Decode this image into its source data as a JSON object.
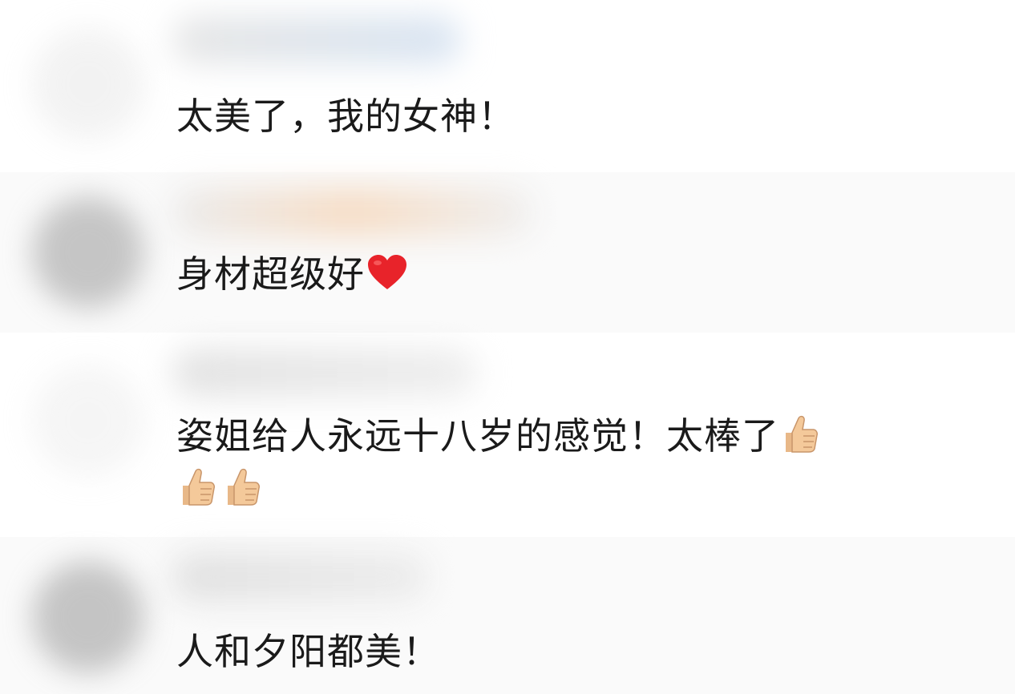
{
  "comments": [
    {
      "text": "太美了，我的女神！",
      "emojis": []
    },
    {
      "text": "身材超级好",
      "emojis": [
        "heart-icon"
      ]
    },
    {
      "text": "姿姐给人永远十八岁的感觉！太棒了",
      "emojis": [
        "thumbs-up-icon",
        "thumbs-up-icon",
        "thumbs-up-icon"
      ]
    },
    {
      "text": "人和夕阳都美！",
      "emojis": []
    }
  ],
  "colors": {
    "text": "#1a1a1a",
    "heart": "#e8232a",
    "thumb": "#f4c99a"
  }
}
